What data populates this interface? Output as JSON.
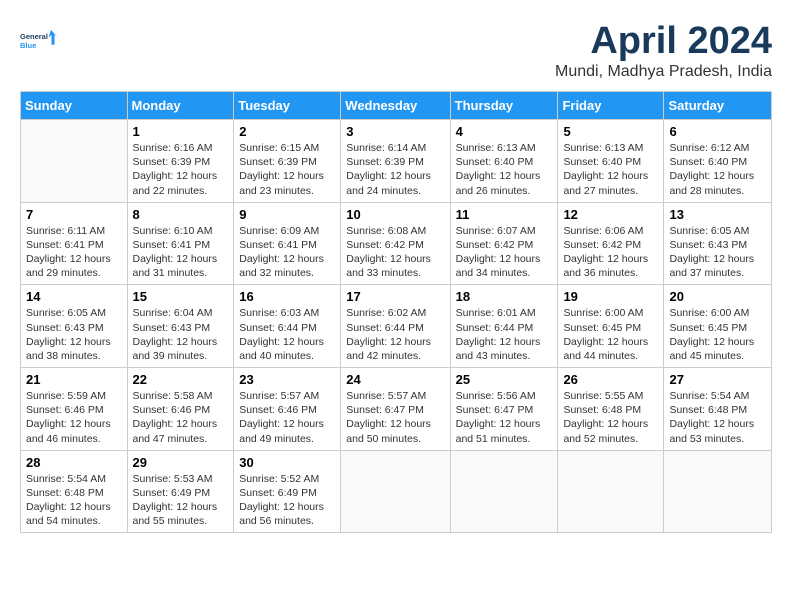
{
  "header": {
    "logo_general": "General",
    "logo_blue": "Blue",
    "title": "April 2024",
    "location": "Mundi, Madhya Pradesh, India"
  },
  "days_of_week": [
    "Sunday",
    "Monday",
    "Tuesday",
    "Wednesday",
    "Thursday",
    "Friday",
    "Saturday"
  ],
  "weeks": [
    [
      {
        "day": "",
        "info": ""
      },
      {
        "day": "1",
        "info": "Sunrise: 6:16 AM\nSunset: 6:39 PM\nDaylight: 12 hours\nand 22 minutes."
      },
      {
        "day": "2",
        "info": "Sunrise: 6:15 AM\nSunset: 6:39 PM\nDaylight: 12 hours\nand 23 minutes."
      },
      {
        "day": "3",
        "info": "Sunrise: 6:14 AM\nSunset: 6:39 PM\nDaylight: 12 hours\nand 24 minutes."
      },
      {
        "day": "4",
        "info": "Sunrise: 6:13 AM\nSunset: 6:40 PM\nDaylight: 12 hours\nand 26 minutes."
      },
      {
        "day": "5",
        "info": "Sunrise: 6:13 AM\nSunset: 6:40 PM\nDaylight: 12 hours\nand 27 minutes."
      },
      {
        "day": "6",
        "info": "Sunrise: 6:12 AM\nSunset: 6:40 PM\nDaylight: 12 hours\nand 28 minutes."
      }
    ],
    [
      {
        "day": "7",
        "info": "Sunrise: 6:11 AM\nSunset: 6:41 PM\nDaylight: 12 hours\nand 29 minutes."
      },
      {
        "day": "8",
        "info": "Sunrise: 6:10 AM\nSunset: 6:41 PM\nDaylight: 12 hours\nand 31 minutes."
      },
      {
        "day": "9",
        "info": "Sunrise: 6:09 AM\nSunset: 6:41 PM\nDaylight: 12 hours\nand 32 minutes."
      },
      {
        "day": "10",
        "info": "Sunrise: 6:08 AM\nSunset: 6:42 PM\nDaylight: 12 hours\nand 33 minutes."
      },
      {
        "day": "11",
        "info": "Sunrise: 6:07 AM\nSunset: 6:42 PM\nDaylight: 12 hours\nand 34 minutes."
      },
      {
        "day": "12",
        "info": "Sunrise: 6:06 AM\nSunset: 6:42 PM\nDaylight: 12 hours\nand 36 minutes."
      },
      {
        "day": "13",
        "info": "Sunrise: 6:05 AM\nSunset: 6:43 PM\nDaylight: 12 hours\nand 37 minutes."
      }
    ],
    [
      {
        "day": "14",
        "info": "Sunrise: 6:05 AM\nSunset: 6:43 PM\nDaylight: 12 hours\nand 38 minutes."
      },
      {
        "day": "15",
        "info": "Sunrise: 6:04 AM\nSunset: 6:43 PM\nDaylight: 12 hours\nand 39 minutes."
      },
      {
        "day": "16",
        "info": "Sunrise: 6:03 AM\nSunset: 6:44 PM\nDaylight: 12 hours\nand 40 minutes."
      },
      {
        "day": "17",
        "info": "Sunrise: 6:02 AM\nSunset: 6:44 PM\nDaylight: 12 hours\nand 42 minutes."
      },
      {
        "day": "18",
        "info": "Sunrise: 6:01 AM\nSunset: 6:44 PM\nDaylight: 12 hours\nand 43 minutes."
      },
      {
        "day": "19",
        "info": "Sunrise: 6:00 AM\nSunset: 6:45 PM\nDaylight: 12 hours\nand 44 minutes."
      },
      {
        "day": "20",
        "info": "Sunrise: 6:00 AM\nSunset: 6:45 PM\nDaylight: 12 hours\nand 45 minutes."
      }
    ],
    [
      {
        "day": "21",
        "info": "Sunrise: 5:59 AM\nSunset: 6:46 PM\nDaylight: 12 hours\nand 46 minutes."
      },
      {
        "day": "22",
        "info": "Sunrise: 5:58 AM\nSunset: 6:46 PM\nDaylight: 12 hours\nand 47 minutes."
      },
      {
        "day": "23",
        "info": "Sunrise: 5:57 AM\nSunset: 6:46 PM\nDaylight: 12 hours\nand 49 minutes."
      },
      {
        "day": "24",
        "info": "Sunrise: 5:57 AM\nSunset: 6:47 PM\nDaylight: 12 hours\nand 50 minutes."
      },
      {
        "day": "25",
        "info": "Sunrise: 5:56 AM\nSunset: 6:47 PM\nDaylight: 12 hours\nand 51 minutes."
      },
      {
        "day": "26",
        "info": "Sunrise: 5:55 AM\nSunset: 6:48 PM\nDaylight: 12 hours\nand 52 minutes."
      },
      {
        "day": "27",
        "info": "Sunrise: 5:54 AM\nSunset: 6:48 PM\nDaylight: 12 hours\nand 53 minutes."
      }
    ],
    [
      {
        "day": "28",
        "info": "Sunrise: 5:54 AM\nSunset: 6:48 PM\nDaylight: 12 hours\nand 54 minutes."
      },
      {
        "day": "29",
        "info": "Sunrise: 5:53 AM\nSunset: 6:49 PM\nDaylight: 12 hours\nand 55 minutes."
      },
      {
        "day": "30",
        "info": "Sunrise: 5:52 AM\nSunset: 6:49 PM\nDaylight: 12 hours\nand 56 minutes."
      },
      {
        "day": "",
        "info": ""
      },
      {
        "day": "",
        "info": ""
      },
      {
        "day": "",
        "info": ""
      },
      {
        "day": "",
        "info": ""
      }
    ]
  ]
}
